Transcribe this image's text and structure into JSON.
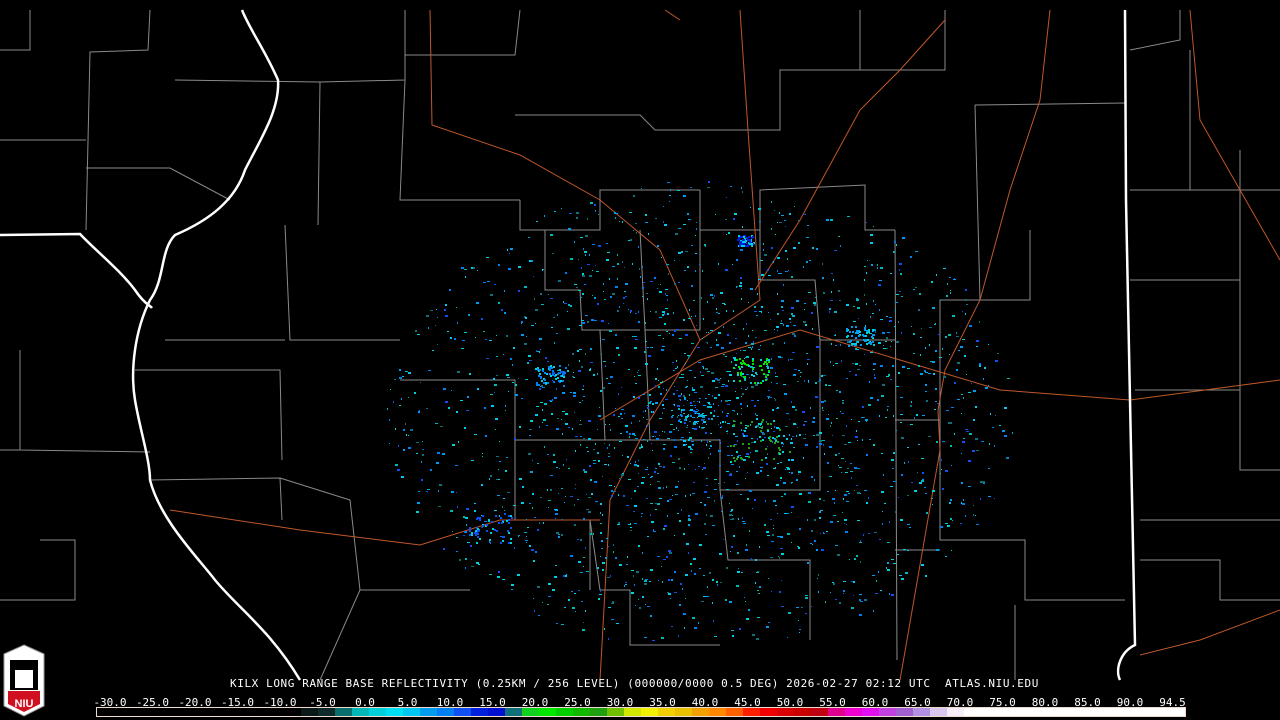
{
  "map": {
    "title": "KILX LONG RANGE BASE REFLECTIVITY (0.25KM / 256 LEVEL) (000000/0000 0.5 DEG) 2026-02-27 02:12 UTC  ATLAS.NIU.EDU",
    "logo_text": "NIU",
    "colors": {
      "county": "#8a8a8a",
      "state": "#ffffff",
      "road": "#c0582a",
      "background": "#000000"
    }
  },
  "legend": {
    "ticks": [
      "-30.0",
      "-25.0",
      "-20.0",
      "-15.0",
      "-10.0",
      "-5.0",
      "0.0",
      "5.0",
      "10.0",
      "15.0",
      "20.0",
      "25.0",
      "30.0",
      "35.0",
      "40.0",
      "45.0",
      "50.0",
      "55.0",
      "60.0",
      "65.0",
      "70.0",
      "75.0",
      "80.0",
      "85.0",
      "90.0",
      "94.5"
    ],
    "colors": [
      "#000000",
      "#000000",
      "#000000",
      "#000000",
      "#000000",
      "#000000",
      "#000000",
      "#000000",
      "#000000",
      "#000000",
      "#000000",
      "#000000",
      "#0a1818",
      "#0f2a2a",
      "#0a6e6e",
      "#00b8b8",
      "#00d0d8",
      "#00e0f0",
      "#00c8f0",
      "#009cf0",
      "#0080f0",
      "#1050f0",
      "#0020e0",
      "#0010d0",
      "#10707a",
      "#10d020",
      "#00e800",
      "#00d000",
      "#10b800",
      "#20a010",
      "#70c000",
      "#d0e800",
      "#f0f000",
      "#f0d000",
      "#e8c000",
      "#f0a000",
      "#ff8800",
      "#ff6000",
      "#ff2000",
      "#f00000",
      "#d80000",
      "#c80000",
      "#c00010",
      "#e00090",
      "#f000d0",
      "#e010f0",
      "#c040e0",
      "#a060d0",
      "#b090e0",
      "#d8c8f0",
      "#f4eef8",
      "#ffffff",
      "#ffffff",
      "#ffffff",
      "#ffffff",
      "#ffffff",
      "#ffffff",
      "#ffffff",
      "#ffffff",
      "#ffffff",
      "#ffffff",
      "#ffffff",
      "#ffffff",
      "#ffffff"
    ]
  }
}
